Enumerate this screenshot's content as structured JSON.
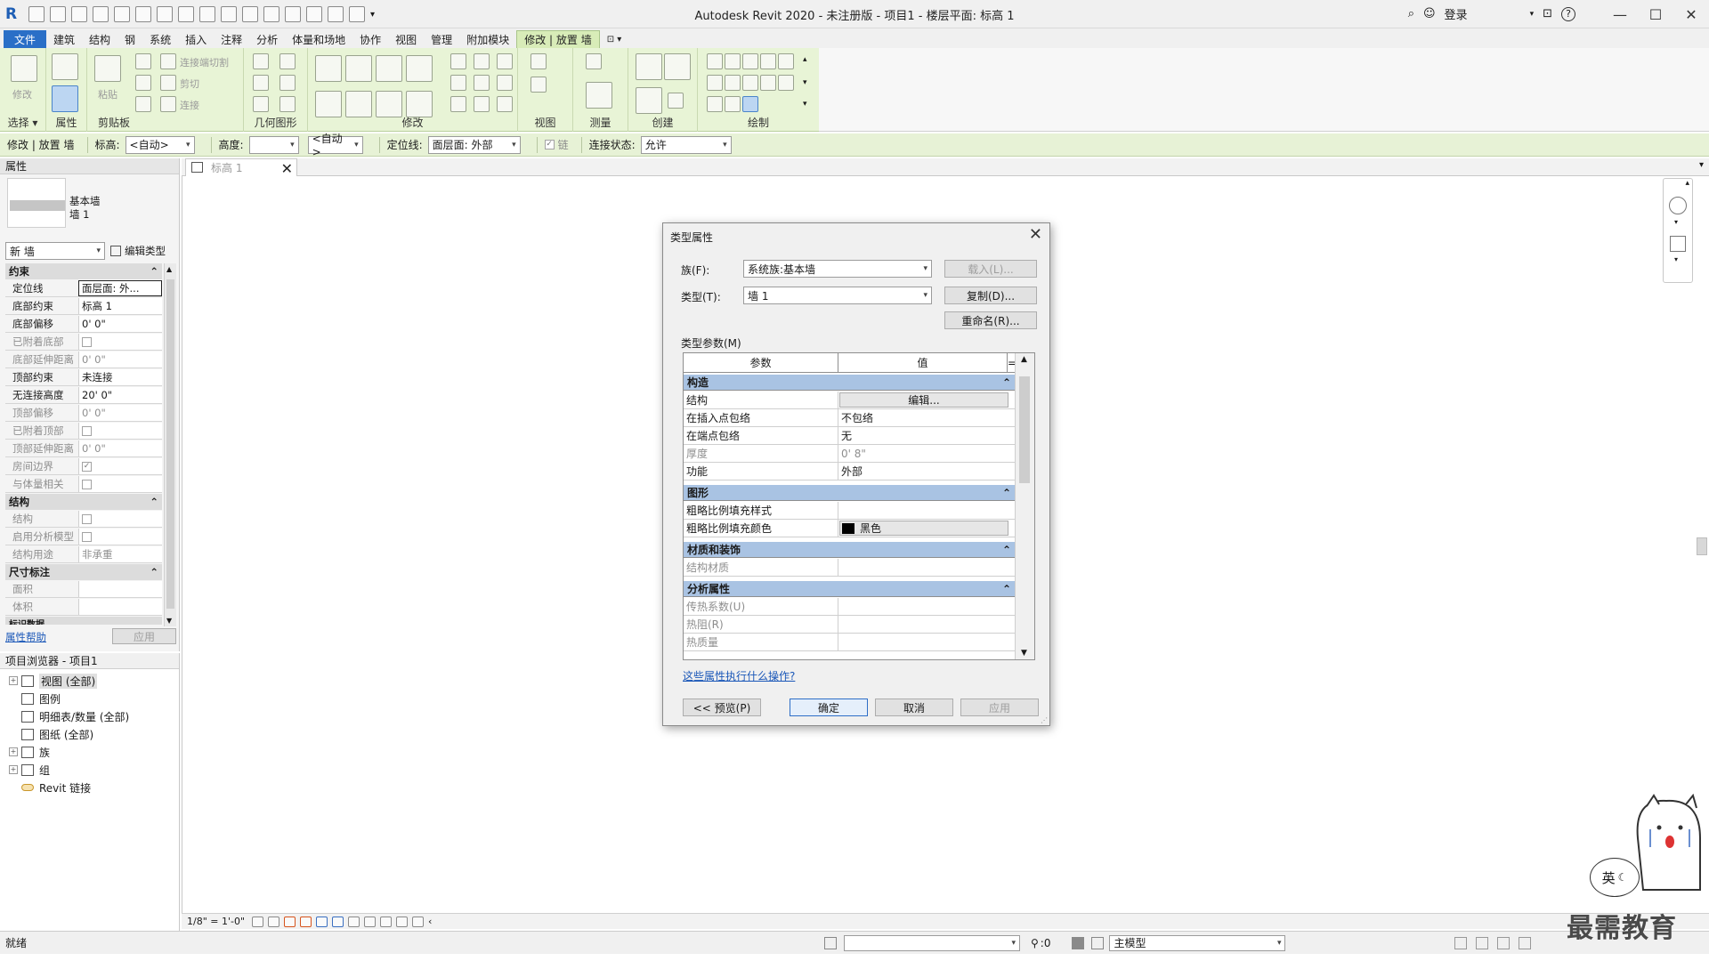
{
  "window": {
    "title": "Autodesk Revit 2020 - 未注册版 - 项目1 - 楼层平面: 标高 1",
    "login_label": "登录",
    "help_label": "?"
  },
  "menu_tabs": [
    "文件",
    "建筑",
    "结构",
    "钢",
    "系统",
    "插入",
    "注释",
    "分析",
    "体量和场地",
    "协作",
    "视图",
    "管理",
    "附加模块",
    "修改 | 放置 墙"
  ],
  "ribbon": {
    "panels": [
      "选择",
      "属性",
      "剪贴板",
      "几何图形",
      "修改",
      "视图",
      "测量",
      "创建",
      "绘制"
    ],
    "items": {
      "modify_label": "修改",
      "paste_label": "粘贴",
      "cut_join": "连接端切割",
      "cut": "剪切",
      "join": "连接"
    },
    "select_dropdown": "▾"
  },
  "options_bar": {
    "context": "修改 | 放置 墙",
    "level_label": "标高:",
    "level_value": "<自动>",
    "height_label": "高度:",
    "height_value": "",
    "height_target": "<自动>",
    "location_label": "定位线:",
    "location_value": "面层面: 外部",
    "chain_label": "链",
    "join_status_label": "连接状态:",
    "join_status_value": "允许"
  },
  "properties": {
    "title": "属性",
    "type_family": "基本墙",
    "type_name": "墙 1",
    "instance_selector": "新 墙",
    "edit_type_label": "编辑类型",
    "categories": {
      "constraints": "约束",
      "structure": "结构",
      "dimensions": "尺寸标注",
      "identity": "标识数据"
    },
    "rows": [
      {
        "k": "定位线",
        "v": "面层面: 外..."
      },
      {
        "k": "底部约束",
        "v": "标高 1"
      },
      {
        "k": "底部偏移",
        "v": "0'  0\""
      },
      {
        "k": "已附着底部",
        "v": ""
      },
      {
        "k": "底部延伸距离",
        "v": "0'  0\""
      },
      {
        "k": "顶部约束",
        "v": "未连接"
      },
      {
        "k": "无连接高度",
        "v": "20'  0\""
      },
      {
        "k": "顶部偏移",
        "v": "0'  0\""
      },
      {
        "k": "已附着顶部",
        "v": ""
      },
      {
        "k": "顶部延伸距离",
        "v": "0'  0\""
      },
      {
        "k": "房间边界",
        "v": ""
      },
      {
        "k": "与体量相关",
        "v": ""
      },
      {
        "k": "结构",
        "v": ""
      },
      {
        "k": "启用分析模型",
        "v": ""
      },
      {
        "k": "结构用途",
        "v": "非承重"
      },
      {
        "k": "面积",
        "v": ""
      },
      {
        "k": "体积",
        "v": ""
      }
    ],
    "help_link": "属性帮助",
    "apply_label": "应用"
  },
  "browser": {
    "title": "项目浏览器 - 项目1",
    "items": [
      "视图 (全部)",
      "图例",
      "明细表/数量 (全部)",
      "图纸 (全部)",
      "族",
      "组",
      "Revit 链接"
    ]
  },
  "view_tab": {
    "label": "标高 1",
    "close": "✕"
  },
  "view_control": {
    "scale": "1/8\" = 1'-0\""
  },
  "status": {
    "left": "就绪",
    "count": ":0",
    "model": "主模型"
  },
  "dialog": {
    "title": "类型属性",
    "family_label": "族(F):",
    "family_value": "系统族:基本墙",
    "type_label": "类型(T):",
    "type_value": "墙 1",
    "load_label": "载入(L)...",
    "duplicate_label": "复制(D)...",
    "rename_label": "重命名(R)...",
    "type_params_label": "类型参数(M)",
    "col_param": "参数",
    "col_value": "值",
    "col_extra": "=",
    "groups": [
      {
        "name": "构造",
        "rows": [
          {
            "k": "结构",
            "v": "编辑...",
            "button": true
          },
          {
            "k": "在插入点包络",
            "v": "不包络"
          },
          {
            "k": "在端点包络",
            "v": "无"
          },
          {
            "k": "厚度",
            "v": "0'  8\"",
            "dim": true
          },
          {
            "k": "功能",
            "v": "外部"
          }
        ]
      },
      {
        "name": "图形",
        "rows": [
          {
            "k": "粗略比例填充样式",
            "v": ""
          },
          {
            "k": "粗略比例填充颜色",
            "v": "黑色",
            "swatch": true
          }
        ]
      },
      {
        "name": "材质和装饰",
        "rows": [
          {
            "k": "结构材质",
            "v": "",
            "dim": true
          }
        ]
      },
      {
        "name": "分析属性",
        "rows": [
          {
            "k": "传热系数(U)",
            "v": "",
            "dim": true
          },
          {
            "k": "热阻(R)",
            "v": "",
            "dim": true
          },
          {
            "k": "热质量",
            "v": "",
            "dim": true
          }
        ]
      }
    ],
    "help_link": "这些属性执行什么操作?",
    "preview_label": "<< 预览(P)",
    "ok_label": "确定",
    "cancel_label": "取消",
    "apply_label": "应用"
  },
  "overlay": {
    "ime_label": "英",
    "watermark": "最需教育"
  },
  "colors": {
    "ribbon_green": "#e8f4d6",
    "file_tab_blue": "#2a6fc7",
    "category_blue": "#a9c3e3",
    "link_blue": "#1a57b8"
  }
}
